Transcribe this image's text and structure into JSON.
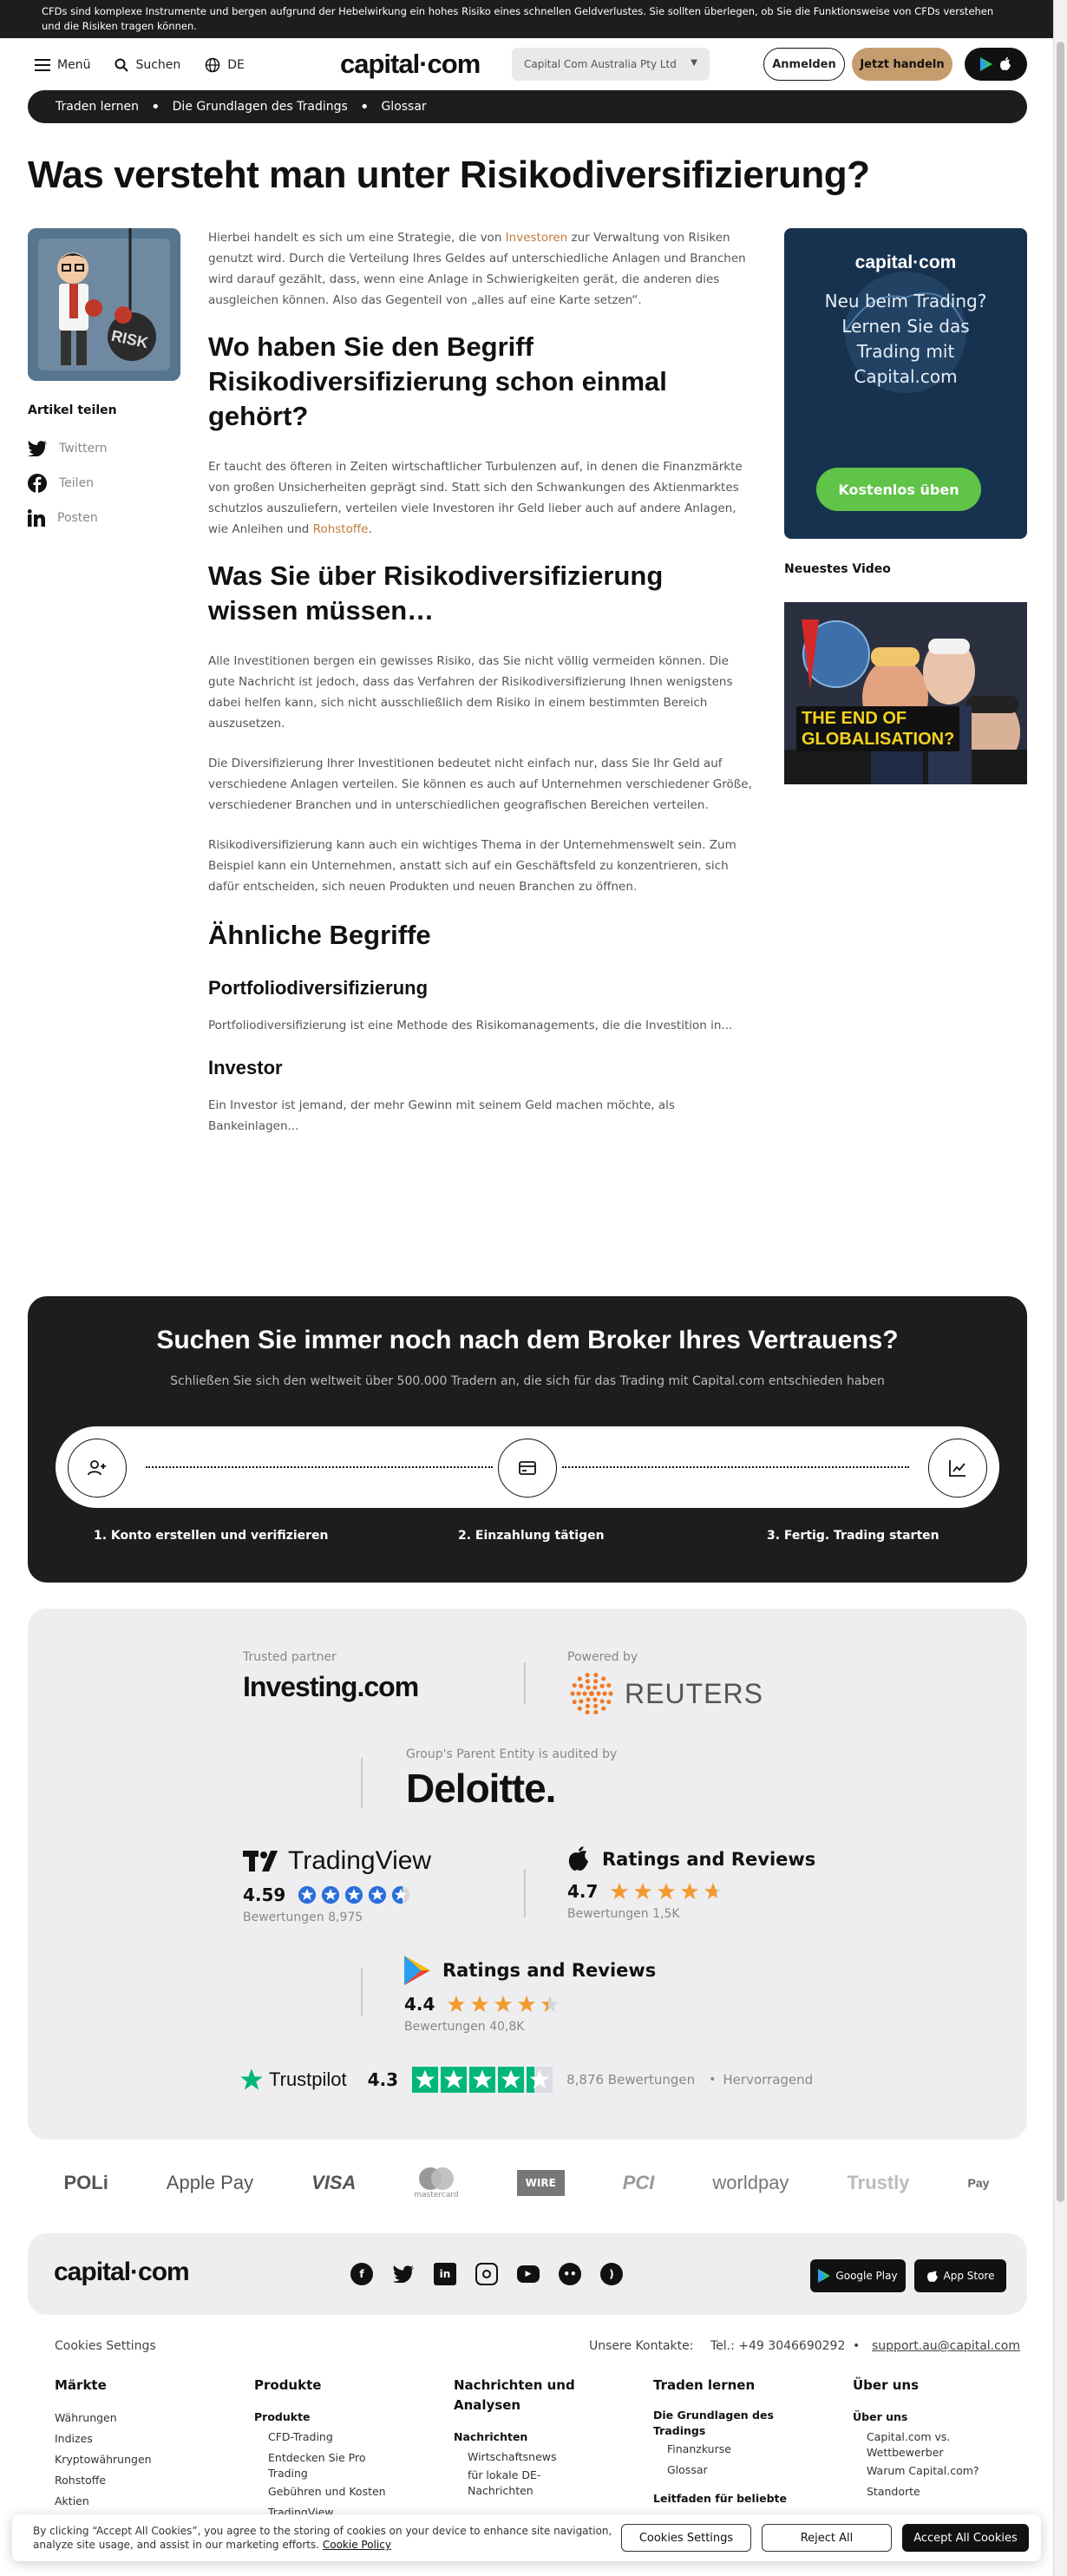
{
  "risk_warning": "CFDs sind komplexe Instrumente und bergen aufgrund der Hebelwirkung ein hohes Risiko eines schnellen Geldverlustes. Sie sollten überlegen, ob Sie die Funktionsweise von CFDs verstehen und die Risiken tragen können.",
  "header": {
    "menu_label": "Menü",
    "search_label": "Suchen",
    "lang_label": "DE",
    "logo": "capital·com",
    "entity": "Capital Com Australia Pty Ltd",
    "login": "Anmelden",
    "trade": "Jetzt handeln"
  },
  "breadcrumbs": [
    "Traden lernen",
    "Die Grundlagen des Tradings",
    "Glossar"
  ],
  "page_title": "Was versteht man unter Risikodiversifizierung?",
  "thumbnail_text": "RISK",
  "share": {
    "label": "Artikel teilen",
    "twitter": "Twittern",
    "facebook": "Teilen",
    "linkedin": "Posten"
  },
  "article": {
    "p1_a": "Hierbei handelt es sich um eine Strategie, die von ",
    "p1_link": "Investoren",
    "p1_b": " zur Verwaltung von Risiken genutzt wird. Durch die Verteilung Ihres Geldes auf unterschiedliche Anlagen und Branchen wird darauf gezählt, dass, wenn eine Anlage in Schwierigkeiten gerät, die anderen dies ausgleichen können. Also das Gegenteil von „alles auf eine Karte setzen“.",
    "h2_1": "Wo haben Sie den Begriff Risikodiversifizierung schon einmal gehört?",
    "p2_a": "Er taucht des öfteren in Zeiten wirtschaftlicher Turbulenzen auf, in denen die Finanzmärkte von großen Unsicherheiten geprägt sind. Statt sich den Schwankungen des Aktienmarktes schutzlos auszuliefern, verteilen viele Investoren ihr Geld lieber auch auf andere Anlagen, wie Anleihen und ",
    "p2_link": "Rohstoffe",
    "p2_b": ".",
    "h2_2": "Was Sie über Risikodiversifizierung wissen müssen…",
    "p3": "Alle Investitionen bergen ein gewisses Risiko, das Sie nicht völlig vermeiden können. Die gute Nachricht ist jedoch, dass das Verfahren der Risikodiversifizierung Ihnen wenigstens dabei helfen kann, sich nicht ausschließlich dem Risiko in einem bestimmten Bereich auszusetzen.",
    "p4": "Die Diversifizierung Ihrer Investitionen bedeutet nicht einfach nur, dass Sie Ihr Geld auf verschiedene Anlagen verteilen. Sie können es auch auf Unternehmen verschiedener Größe, verschiedener Branchen und in unterschiedlichen geografischen Bereichen verteilen.",
    "p5": "Risikodiversifizierung kann auch ein wichtiges Thema in der Unternehmenswelt sein. Zum Beispiel kann ein Unternehmen, anstatt sich auf ein Geschäftsfeld zu konzentrieren, sich dafür entscheiden, sich neuen Produkten und neuen Branchen zu öffnen.",
    "h2_3": "Ähnliche Begriffe",
    "term1_title": "Portfoliodiversifizierung",
    "term1_text": "Portfoliodiversifizierung ist eine Methode des Risikomanagements, die die Investition in...",
    "term2_title": "Investor",
    "term2_text": "Ein Investor ist jemand, der mehr Gewinn mit seinem Geld machen möchte, als Bankeinlagen..."
  },
  "promo": {
    "logo": "capital·com",
    "text": "Neu beim Trading? Lernen Sie das Trading mit Capital.com",
    "button": "Kostenlos üben"
  },
  "video": {
    "label": "Neuestes Video",
    "title_line1": "THE END OF",
    "title_line2": "GLOBALISATION?"
  },
  "broker": {
    "title": "Suchen Sie immer noch nach dem Broker Ihres Vertrauens?",
    "subtitle": "Schließen Sie sich den weltweit über 500.000 Tradern an, die sich für das Trading mit Capital.com entschieden haben",
    "step1": "1. Konto erstellen und verifizieren",
    "step2": "2. Einzahlung tätigen",
    "step3": "3. Fertig. Trading starten"
  },
  "trust": {
    "investing_label": "Trusted partner",
    "investing_logo": "Investing.com",
    "reuters_label": "Powered by",
    "reuters_logo": "REUTERS",
    "deloitte_label": "Group's Parent Entity is audited by",
    "deloitte_logo": "Deloitte.",
    "tradingview_logo": "TradingView",
    "tradingview_score": "4.59",
    "tradingview_reviews": "Bewertungen 8,975",
    "tradingview_rating": 4.59,
    "apple_title": "Ratings and Reviews",
    "apple_score": "4.7",
    "apple_reviews": "Bewertungen 1,5K",
    "apple_rating": 4.7,
    "google_title": "Ratings and Reviews",
    "google_score": "4.4",
    "google_reviews": "Bewertungen 40,8K",
    "google_rating": 4.4,
    "trustpilot_logo": "Trustpilot",
    "trustpilot_score": "4.3",
    "trustpilot_rating": 4.3,
    "trustpilot_reviews": "8,876 Bewertungen",
    "trustpilot_label": "Hervorragend",
    "colors": {
      "star_blue": "#2a6edb",
      "star_orange": "#f29a2e",
      "trustpilot_green": "#00b67a"
    }
  },
  "payments": [
    "POLi",
    "Apple Pay",
    "VISA",
    "mastercard",
    "WIRE",
    "PCI",
    "worldpay",
    "Trustly",
    "Pay"
  ],
  "footer": {
    "logo": "capital·com",
    "google_play": "Google Play",
    "app_store": "App Store",
    "cookies_settings": "Cookies Settings",
    "contacts_label": "Unsere Kontakte:",
    "phone": "Tel.: +49 3046690292",
    "email": "support.au@capital.com",
    "col1_title": "Märkte",
    "col1_items": [
      "Währungen",
      "Indizes",
      "Kryptowährungen",
      "Rohstoffe",
      "Aktien"
    ],
    "col2_title": "Produkte",
    "col2_sub": "Produkte",
    "col2_items": [
      "CFD-Trading",
      "Entdecken Sie Pro Trading",
      "Gebühren und Kosten",
      "TradingView"
    ],
    "col3_title": "Nachrichten und Analysen",
    "col3_sub": "Nachrichten",
    "col3_items": [
      "Wirtschaftsnews",
      "für lokale DE-Nachrichten"
    ],
    "col4_title": "Traden lernen",
    "col4_sub": "Die Grundlagen des Tradings",
    "col4_items": [
      "Finanzkurse",
      "Glossar"
    ],
    "col4_sub2": "Leitfaden für beliebte",
    "col5_title": "Über uns",
    "col5_sub": "Über uns",
    "col5_items": [
      "Capital.com vs. Wettbewerber",
      "Warum Capital.com?",
      "Standorte"
    ]
  },
  "cookie_banner": {
    "text": "By clicking “Accept All Cookies”, you agree to the storing of cookies on your device to enhance site navigation, analyze site usage, and assist in our marketing efforts.",
    "policy_link": "Cookie Policy",
    "settings": "Cookies Settings",
    "reject": "Reject All",
    "accept": "Accept All Cookies"
  }
}
